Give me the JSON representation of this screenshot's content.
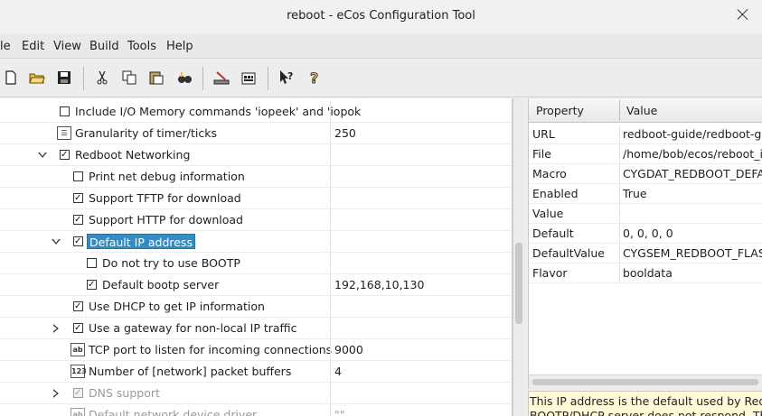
{
  "window": {
    "title": "reboot - eCos Configuration Tool"
  },
  "menu": [
    "le",
    "Edit",
    "View",
    "Build",
    "Tools",
    "Help"
  ],
  "toolbar": [
    "new-icon",
    "open-icon",
    "save-icon",
    "cut-icon",
    "copy-icon",
    "paste-icon",
    "find-icon",
    "build-icon",
    "package-icon",
    "whats-this-icon",
    "help-icon"
  ],
  "tree": {
    "rows": [
      {
        "label": "Include I/O Memory commands 'iopeek' and 'iopok",
        "value": "",
        "kind": "checkbox",
        "checked": false
      },
      {
        "label": "Granularity of timer/ticks",
        "value": "250",
        "kind": "list"
      },
      {
        "label": "Redboot Networking",
        "value": "",
        "kind": "checkbox",
        "checked": true,
        "expander": "down"
      },
      {
        "label": "Print net debug information",
        "value": "",
        "kind": "checkbox",
        "checked": false
      },
      {
        "label": "Support TFTP for download",
        "value": "",
        "kind": "checkbox",
        "checked": true
      },
      {
        "label": "Support HTTP for download",
        "value": "",
        "kind": "checkbox",
        "checked": true
      },
      {
        "label": "Default IP address",
        "value": "",
        "kind": "checkbox",
        "checked": true,
        "expander": "down",
        "selected": true
      },
      {
        "label": "Do not try to use BOOTP",
        "value": "",
        "kind": "checkbox",
        "checked": false
      },
      {
        "label": "Default bootp server",
        "value": "192,168,10,130",
        "kind": "checkbox",
        "checked": true
      },
      {
        "label": "Use DHCP to get IP information",
        "value": "",
        "kind": "checkbox",
        "checked": true
      },
      {
        "label": "Use a gateway for non-local IP traffic",
        "value": "",
        "kind": "checkbox",
        "checked": true,
        "expander": "right"
      },
      {
        "label": "TCP port to listen for incoming connections",
        "value": "9000",
        "kind": "text"
      },
      {
        "label": "Number of [network] packet buffers",
        "value": "4",
        "kind": "number"
      },
      {
        "label": "DNS support",
        "value": "",
        "kind": "checkbox",
        "checked": true,
        "expander": "right",
        "disabled": true
      },
      {
        "label": "Default network device driver",
        "value": "\"\"",
        "kind": "text",
        "disabled": true
      }
    ]
  },
  "properties": {
    "headers": {
      "property": "Property",
      "value": "Value"
    },
    "rows": [
      {
        "key": "URL",
        "value": "redboot-guide/redboot-guid"
      },
      {
        "key": "File",
        "value": "/home/bob/ecos/reboot_ins"
      },
      {
        "key": "Macro",
        "value": "CYGDAT_REDBOOT_DEFAUL"
      },
      {
        "key": "Enabled",
        "value": "True"
      },
      {
        "key": "Value",
        "value": ""
      },
      {
        "key": "Default",
        "value": "0, 0, 0, 0"
      },
      {
        "key": "DefaultValue",
        "value": "CYGSEM_REDBOOT_FLASH_"
      },
      {
        "key": "Flavor",
        "value": "booldata"
      }
    ]
  },
  "description": {
    "line1": "This IP address is the default used by RedBoot",
    "line2": "BOOTP/DHCP server does not respond. The"
  }
}
